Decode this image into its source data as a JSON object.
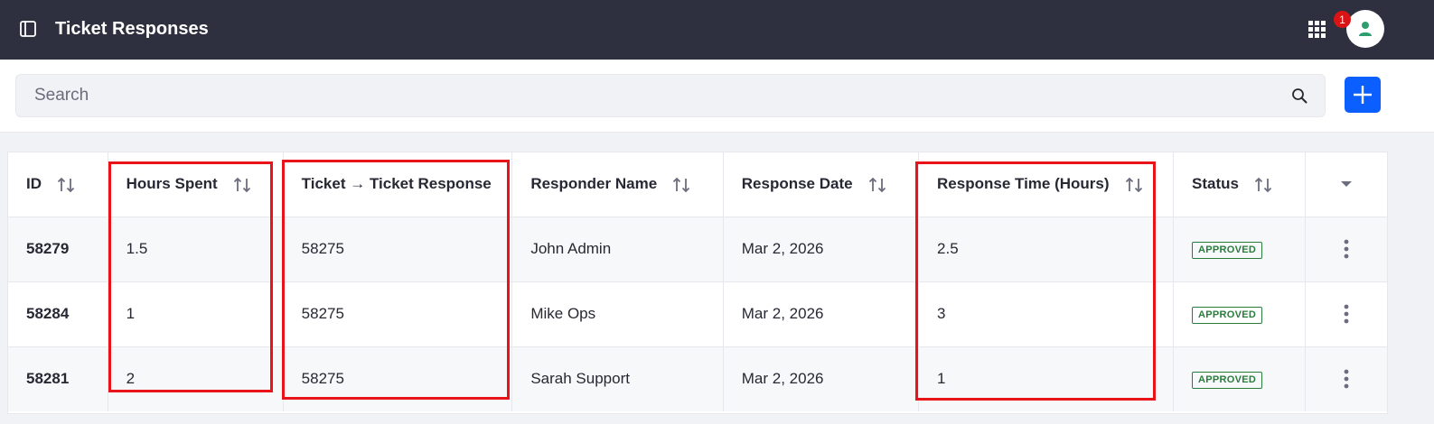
{
  "header": {
    "title": "Ticket Responses",
    "notification_count": "1"
  },
  "search": {
    "placeholder": "Search",
    "value": ""
  },
  "table": {
    "columns": [
      {
        "key": "id",
        "label": "ID",
        "sortable": true
      },
      {
        "key": "hours_spent",
        "label": "Hours Spent",
        "sortable": true
      },
      {
        "key": "ticket",
        "label": "Ticket → Ticket Response",
        "sortable": false
      },
      {
        "key": "responder",
        "label": "Responder Name",
        "sortable": true
      },
      {
        "key": "date",
        "label": "Response Date",
        "sortable": true
      },
      {
        "key": "response_time",
        "label": "Response Time (Hours)",
        "sortable": true
      },
      {
        "key": "status",
        "label": "Status",
        "sortable": true
      }
    ],
    "rows": [
      {
        "id": "58279",
        "hours_spent": "1.5",
        "ticket": "58275",
        "responder": "John Admin",
        "date": "Mar 2, 2026",
        "response_time": "2.5",
        "status": "APPROVED"
      },
      {
        "id": "58284",
        "hours_spent": "1",
        "ticket": "58275",
        "responder": "Mike Ops",
        "date": "Mar 2, 2026",
        "response_time": "3",
        "status": "APPROVED"
      },
      {
        "id": "58281",
        "hours_spent": "2",
        "ticket": "58275",
        "responder": "Sarah Support",
        "date": "Mar 2, 2026",
        "response_time": "1",
        "status": "APPROVED"
      }
    ]
  },
  "colors": {
    "topbar": "#2e3040",
    "accent": "#0b5fff",
    "status_approved": "#287d3c",
    "highlight": "#e8141a",
    "notification": "#da1414"
  },
  "icons": {
    "sidebar_toggle": "sidebar-toggle-icon",
    "apps": "apps-grid-icon",
    "avatar": "user-icon",
    "search": "search-icon",
    "add": "plus-icon",
    "sort": "sort-arrows-icon",
    "column_menu": "caret-down-icon",
    "row_actions": "kebab-icon"
  }
}
